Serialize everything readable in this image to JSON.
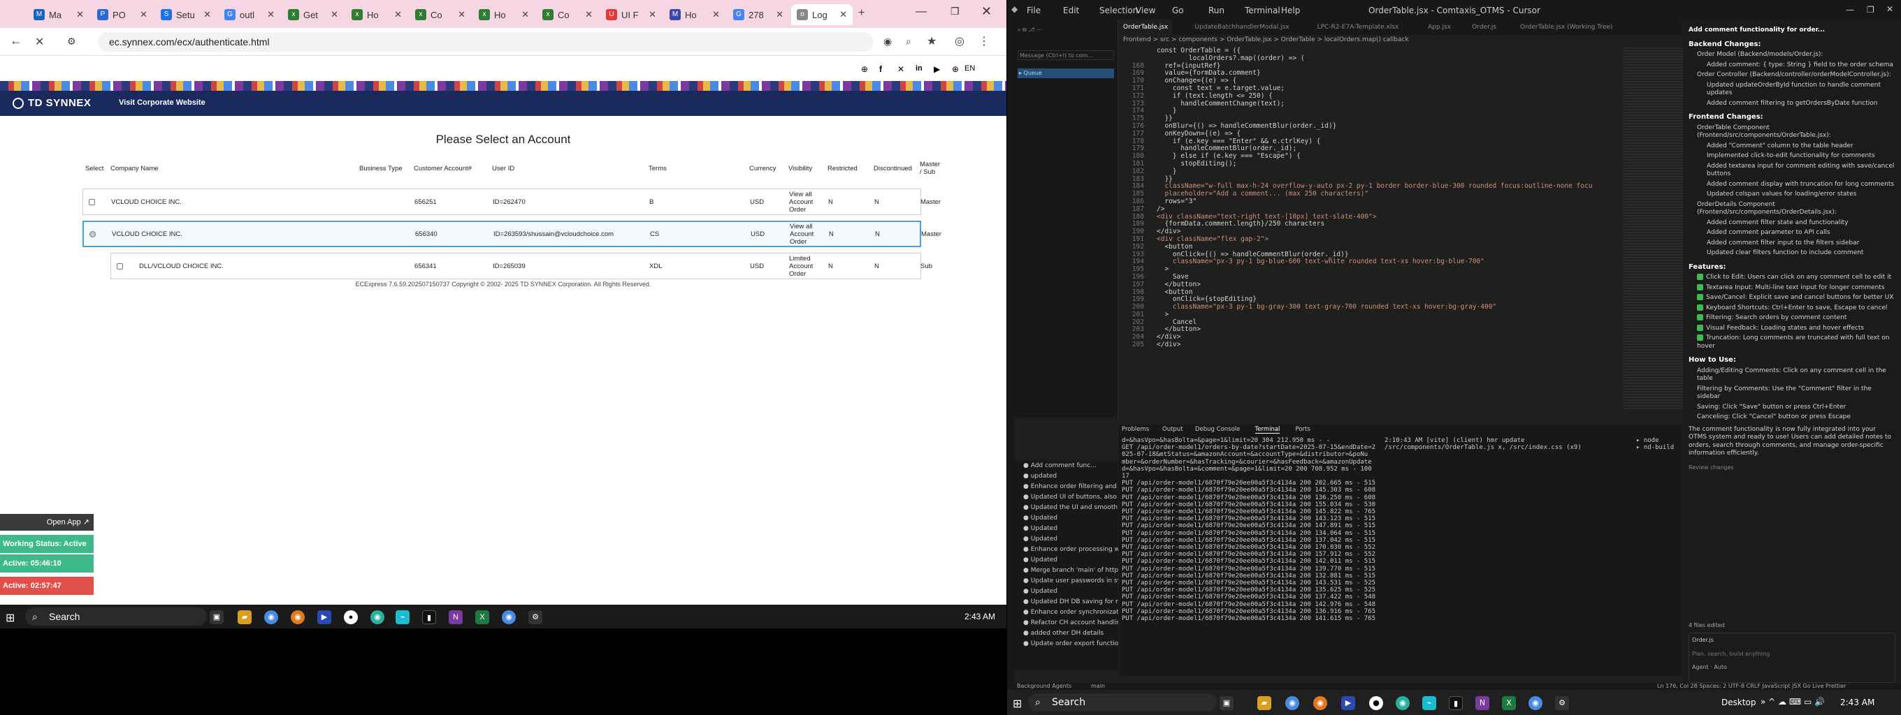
{
  "browser": {
    "tabs": [
      {
        "label": "Ma",
        "color": "#1565c0",
        "icon": "M"
      },
      {
        "label": "PO",
        "color": "#2a6ad0",
        "icon": "P"
      },
      {
        "label": "Setu",
        "color": "#1a73e8",
        "icon": "S"
      },
      {
        "label": "outl",
        "color": "#4285f4",
        "icon": "G"
      },
      {
        "label": "Get",
        "color": "#2e7d32",
        "icon": "x"
      },
      {
        "label": "Ho",
        "color": "#2e7d32",
        "icon": "x"
      },
      {
        "label": "Co",
        "color": "#2e7d32",
        "icon": "x"
      },
      {
        "label": "Ho",
        "color": "#2e7d32",
        "icon": "x"
      },
      {
        "label": "Co",
        "color": "#2e7d32",
        "icon": "x"
      },
      {
        "label": "UI F",
        "color": "#e53935",
        "icon": "U"
      },
      {
        "label": "Ho",
        "color": "#3949ab",
        "icon": "M"
      },
      {
        "label": "278",
        "color": "#4285f4",
        "icon": "G"
      },
      {
        "label": "Log",
        "color": "#888888",
        "icon": "o"
      }
    ],
    "url": "ec.synnex.com/ecx/authenticate.html",
    "header_langs": "EN"
  },
  "page": {
    "brand": "TD SYNNEX",
    "corp_link": "Visit Corporate Website",
    "title": "Please Select an Account",
    "columns": [
      "Select",
      "Company Name",
      "Business Type",
      "Customer Account#",
      "User ID",
      "Terms",
      "Currency",
      "Visibility",
      "Restricted",
      "Discontinued",
      "Master / Sub"
    ],
    "rows": [
      {
        "company": "VCLOUD CHOICE INC.",
        "btype": "",
        "account": "656251",
        "userid": "ID=262470",
        "terms": "B",
        "currency": "USD",
        "visibility": "View all Account Order",
        "restricted": "N",
        "discontinued": "N",
        "master": "Master",
        "selected": false
      },
      {
        "company": "VCLOUD CHOICE INC.",
        "btype": "",
        "account": "656340",
        "userid": "ID=263593/shussain@vcloudchoice.com",
        "terms": "CS",
        "currency": "USD",
        "visibility": "View all Account Order",
        "restricted": "N",
        "discontinued": "N",
        "master": "Master",
        "selected": true
      },
      {
        "company": "DLL/VCLOUD CHOICE INC.",
        "btype": "",
        "account": "656341",
        "userid": "ID=265039",
        "terms": "XDL",
        "currency": "USD",
        "visibility": "Limited Account Order",
        "restricted": "N",
        "discontinued": "N",
        "master": "Sub",
        "selected": false
      }
    ],
    "footer": "ECExpress 7.6.59.202507150737 Copyright © 2002- 2025 TD SYNNEX Corporation. All Rights Reserved."
  },
  "widget": {
    "open_app": "Open App",
    "status": "Working Status: Active",
    "active1": "Active: 05:46:10",
    "active2": "Active: 02:57:47"
  },
  "taskbar_left": {
    "search": "Search",
    "time": "2:43 AM"
  },
  "vscode": {
    "title": "OrderTable.jsx - Comtaxis_OTMS - Cursor",
    "menus": [
      "File",
      "Edit",
      "Selection",
      "View",
      "Go",
      "Run",
      "Terminal",
      "Help"
    ],
    "tabs": [
      "OrderTable.jsx",
      "UpdateBatchhandlerModal.jsx",
      "LPC-R2-E7A-Template.xlsx",
      "App.jsx",
      "Order.js",
      "OrderTable.jsx (Working Tree)"
    ],
    "breadcrumb": "Frontend > src > components > OrderTable.jsx > OrderTable > localOrders.map() callback",
    "chat_input": "Message (Ctrl+I) to com...",
    "code_lines": [
      {
        "n": "",
        "t": "const OrderTable = ({"
      },
      {
        "n": "",
        "t": "        localOrders?.map((order) => ("
      },
      {
        "n": "168",
        "t": "  ref={inputRef}"
      },
      {
        "n": "169",
        "t": "  value={formData.comment}"
      },
      {
        "n": "170",
        "t": "  onChange={(e) => {"
      },
      {
        "n": "171",
        "t": "    const text = e.target.value;"
      },
      {
        "n": "172",
        "t": "    if (text.length <= 250) {"
      },
      {
        "n": "173",
        "t": "      handleCommentChange(text);"
      },
      {
        "n": "174",
        "t": "    }"
      },
      {
        "n": "175",
        "t": "  }}"
      },
      {
        "n": "176",
        "t": "  onBlur={() => handleCommentBlur(order._id)}"
      },
      {
        "n": "177",
        "t": "  onKeyDown={(e) => {"
      },
      {
        "n": "178",
        "t": "    if (e.key === \"Enter\" && e.ctrlKey) {"
      },
      {
        "n": "179",
        "t": "      handleCommentBlur(order._id);"
      },
      {
        "n": "180",
        "t": "    } else if (e.key === \"Escape\") {"
      },
      {
        "n": "181",
        "t": "      stopEditing();"
      },
      {
        "n": "182",
        "t": "    }"
      },
      {
        "n": "183",
        "t": "  }}"
      },
      {
        "n": "184",
        "t": "  className=\"w-full max-h-24 overflow-y-auto px-2 py-1 border border-blue-300 rounded focus:outline-none focu"
      },
      {
        "n": "185",
        "t": "  placeholder=\"Add a comment... (max 250 characters)\""
      },
      {
        "n": "186",
        "t": "  rows=\"3\""
      },
      {
        "n": "187",
        "t": "/>"
      },
      {
        "n": "188",
        "t": "<div className=\"text-right text-[10px] text-slate-400\">"
      },
      {
        "n": "189",
        "t": "  {formData.comment.length}/250 characters"
      },
      {
        "n": "190",
        "t": "</div>"
      },
      {
        "n": "191",
        "t": "<div className=\"flex gap-2\">"
      },
      {
        "n": "192",
        "t": "  <button"
      },
      {
        "n": "193",
        "t": "    onClick={() => handleCommentBlur(order._id)}"
      },
      {
        "n": "194",
        "t": "    className=\"px-3 py-1 bg-blue-600 text-white rounded text-xs hover:bg-blue-700\""
      },
      {
        "n": "195",
        "t": "  >"
      },
      {
        "n": "196",
        "t": "    Save"
      },
      {
        "n": "197",
        "t": "  </button>"
      },
      {
        "n": "198",
        "t": "  <button"
      },
      {
        "n": "199",
        "t": "    onClick={stopEditing}"
      },
      {
        "n": "200",
        "t": "    className=\"px-3 py-1 bg-gray-300 text-gray-700 rounded text-xs hover:bg-gray-400\""
      },
      {
        "n": "201",
        "t": "  >"
      },
      {
        "n": "202",
        "t": "    Cancel"
      },
      {
        "n": "203",
        "t": "  </button>"
      },
      {
        "n": "204",
        "t": "</div>"
      },
      {
        "n": "205",
        "t": "</div>"
      }
    ],
    "panel_tabs": [
      "Problems",
      "Output",
      "Debug Console",
      "Terminal",
      "Ports"
    ],
    "terminal_lines": [
      "d=&hasVpo=&hasBolta=&page=1&limit=20 304 212.950 ms - -",
      "GET /api/order-model1/orders-by-date?startDate=2025-07-15&endDate=2",
      "025-07-18&mtStatus=&amazonAccount=&accountType=&distributor=&poNu",
      "mber=&orderNumber=&hasTracking=&courier=&hasFeedback=&amazonUpdate",
      "d=&hasVpo=&hasBolta=&comment=&page=1&limit=20 200 708.952 ms - 100",
      "17",
      "PUT /api/order-model1/6870f79e20ee00a5f3c4134a 200 202.665 ms - 515",
      "PUT /api/order-model1/6870f79e20ee00a5f3c4134a 200 145.303 ms - 608",
      "PUT /api/order-model1/6870f79e20ee00a5f3c4134a 200 136.250 ms - 608",
      "PUT /api/order-model1/6870f79e20ee00a5f3c4134a 200 155.034 ms - 530",
      "PUT /api/order-model1/6870f79e20ee00a5f3c4134a 200 145.822 ms - 765",
      "PUT /api/order-model1/6870f79e20ee00a5f3c4134a 200 143.123 ms - 515",
      "PUT /api/order-model1/6870f79e20ee00a5f3c4134a 200 147.891 ms - 515",
      "PUT /api/order-model1/6870f79e20ee00a5f3c4134a 200 134.064 ms - 515",
      "PUT /api/order-model1/6870f79e20ee00a5f3c4134a 200 137.042 ms - 515",
      "PUT /api/order-model1/6870f79e20ee00a5f3c4134a 200 170.030 ms - 552",
      "PUT /api/order-model1/6870f79e20ee00a5f3c4134a 200 157.912 ms - 552",
      "PUT /api/order-model1/6870f79e20ee00a5f3c4134a 200 142.011 ms - 515",
      "PUT /api/order-model1/6870f79e20ee00a5f3c4134a 200 139.770 ms - 515",
      "PUT /api/order-model1/6870f79e20ee00a5f3c4134a 200 132.881 ms - 515",
      "PUT /api/order-model1/6870f79e20ee00a5f3c4134a 200 143.531 ms - 525",
      "PUT /api/order-model1/6870f79e20ee00a5f3c4134a 200 135.625 ms - 525",
      "PUT /api/order-model1/6870f79e20ee00a5f3c4134a 200 137.422 ms - 548",
      "PUT /api/order-model1/6870f79e20ee00a5f3c4134a 200 142.976 ms - 548",
      "PUT /api/order-model1/6870f79e20ee00a5f3c4134a 200 136.916 ms - 765",
      "PUT /api/order-model1/6870f79e20ee00a5f3c4134a 200 141.615 ms - 765"
    ],
    "vite_line": "2:10:43 AM [vite] (client) hmr update /src/components/OrderTable.js x, /src/index.css (x9)",
    "term_list": [
      "node",
      "nd-build"
    ],
    "agent_items": [
      "Add comment func...",
      "updated",
      "Enhance order filtering and trac...",
      "Updated UI of buttons, also cha...",
      "Updated the UI and smooth inp...",
      "Updated",
      "Updated",
      "Updated",
      "Enhance order processing with i...",
      "Updated",
      "Merge branch 'main' of https://...",
      "Update user passwords in syn...",
      "Updated",
      "Updated DH DB saving for ret...",
      "Enhance order synchronization ...",
      "Refactor CH account handling a...",
      "added other DH details",
      "Update order export functionalit..."
    ],
    "right_panel": {
      "heading": "Add comment functionality for order...",
      "backend": "Backend Changes:",
      "b1": "Order Model (Backend/models/Order.js):",
      "b1a": "Added comment: { type: String } field to the order schema",
      "b2": "Order Controller (Backend/controller/orderModelController.js):",
      "b2a": "Updated updateOrderById function to handle comment updates",
      "b2b": "Added comment filtering to getOrdersByDate function",
      "frontend": "Frontend Changes:",
      "f1": "OrderTable Component (Frontend/src/components/OrderTable.jsx):",
      "f1a": "Added \"Comment\" column to the table header",
      "f1b": "Implemented click-to-edit functionality for comments",
      "f1c": "Added textarea input for comment editing with save/cancel buttons",
      "f1d": "Added comment display with truncation for long comments",
      "f1e": "Updated colspan values for loading/error states",
      "f2": "OrderDetails Component (Frontend/src/components/OrderDetails.jsx):",
      "f2a": "Added comment filter state and functionality",
      "f2b": "Added comment parameter to API calls",
      "f2c": "Added comment filter input to the filters sidebar",
      "f2d": "Updated clear filters function to include comment",
      "features": "Features:",
      "feat": [
        "Click to Edit: Users can click on any comment cell to edit it",
        "Textarea Input: Multi-line text input for longer comments",
        "Save/Cancel: Explicit save and cancel buttons for better UX",
        "Keyboard Shortcuts: Ctrl+Enter to save, Escape to cancel",
        "Filtering: Search orders by comment content",
        "Visual Feedback: Loading states and hover effects",
        "Truncation: Long comments are truncated with full text on hover"
      ],
      "howto": "How to Use:",
      "h1": "Adding/Editing Comments: Click on any comment cell in the table",
      "h2": "Filtering by Comments: Use the \"Comment\" filter in the sidebar",
      "h3": "Saving: Click \"Save\" button or press Ctrl+Enter",
      "h4": "Canceling: Click \"Cancel\" button or press Escape",
      "summary": "The comment functionality is now fully integrated into your OTMS system and ready to use! Users can add detailed notes to orders, search through comments, and manage order-specific information efficiently.",
      "review": "Review changes",
      "files": "4 files edited",
      "file1": "Order.js",
      "plan": "Plan, search, build anything",
      "agent": "Agent",
      "auto": "Auto"
    },
    "status_left": "Background Agents",
    "status_branch": "main",
    "status_right": "Ln 176, Col 28   Spaces: 2   UTF-8   CRLF   JavaScript JSX   Go Live   Prettier"
  },
  "taskbar_right": {
    "search": "Search",
    "desktop": "Desktop",
    "time": "2:43 AM"
  }
}
